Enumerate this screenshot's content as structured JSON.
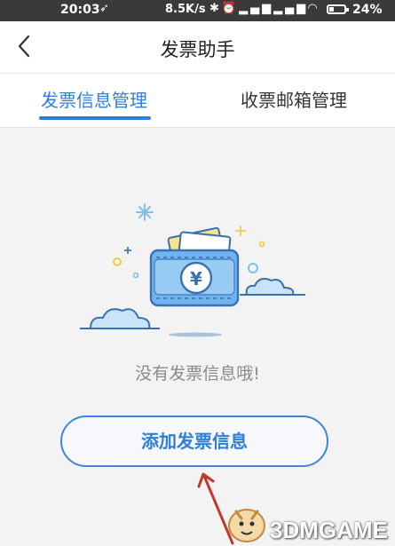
{
  "status_bar": {
    "time": "20:03",
    "network_speed": "8.5K/s",
    "battery_percent": "24%",
    "icons": [
      "navigation-icon",
      "bluetooth-icon",
      "alarm-icon",
      "signal-hd-icon",
      "signal-hd-icon",
      "wifi-icon",
      "battery-icon"
    ]
  },
  "header": {
    "title": "发票助手",
    "back_icon": "chevron-left-icon"
  },
  "tabs": [
    {
      "label": "发票信息管理",
      "active": true
    },
    {
      "label": "收票邮箱管理",
      "active": false
    }
  ],
  "empty_state": {
    "illustration": "empty-invoice-wallet-illustration",
    "message": "没有发票信息哦!"
  },
  "actions": {
    "add_invoice_label": "添加发票信息"
  },
  "watermark": {
    "text": "3DMGAME"
  },
  "colors": {
    "accent": "#2f7fd6",
    "status_bar_bg": "#3a3a3a",
    "page_bg": "#f3f3f3",
    "muted_text": "#8a8a8a",
    "illustration_blue": "#5aa6e8",
    "illustration_yellow": "#f5c842",
    "annotation_arrow": "#c0392b"
  }
}
